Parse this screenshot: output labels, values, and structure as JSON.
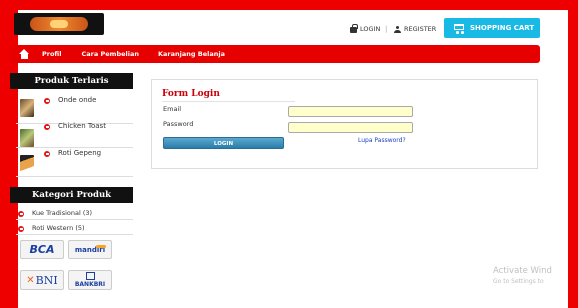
{
  "header": {
    "login_label": "LOGIN",
    "register_label": "REGISTER",
    "cart_label": "SHOPPING CART"
  },
  "nav": {
    "items": [
      "Profil",
      "Cara Pembelian",
      "Karanjang Belanja"
    ]
  },
  "sidebar": {
    "best_title": "Produk Terlaris",
    "products": [
      "Onde onde",
      "Chicken Toast",
      "Roti Gepeng"
    ],
    "category_title": "Kategori Produk",
    "categories": [
      "Kue Tradisional (3)",
      "Roti Western (5)"
    ],
    "banks": [
      "BCA",
      "mandiri",
      "BNI",
      "BANKBRI"
    ]
  },
  "login": {
    "title": "Form Login",
    "email_label": "Email",
    "password_label": "Password",
    "email_value": "",
    "password_value": "",
    "button_label": "LOGIN",
    "forgot_label": "Lupa Password?"
  },
  "watermark": {
    "line1": "Activate Wind",
    "line2": "Go to Settings to"
  },
  "colors": {
    "background": "#ee0000",
    "nav": "#e60000",
    "cart": "#19b9e6",
    "title": "#c8000a",
    "input": "#ffffcc"
  }
}
